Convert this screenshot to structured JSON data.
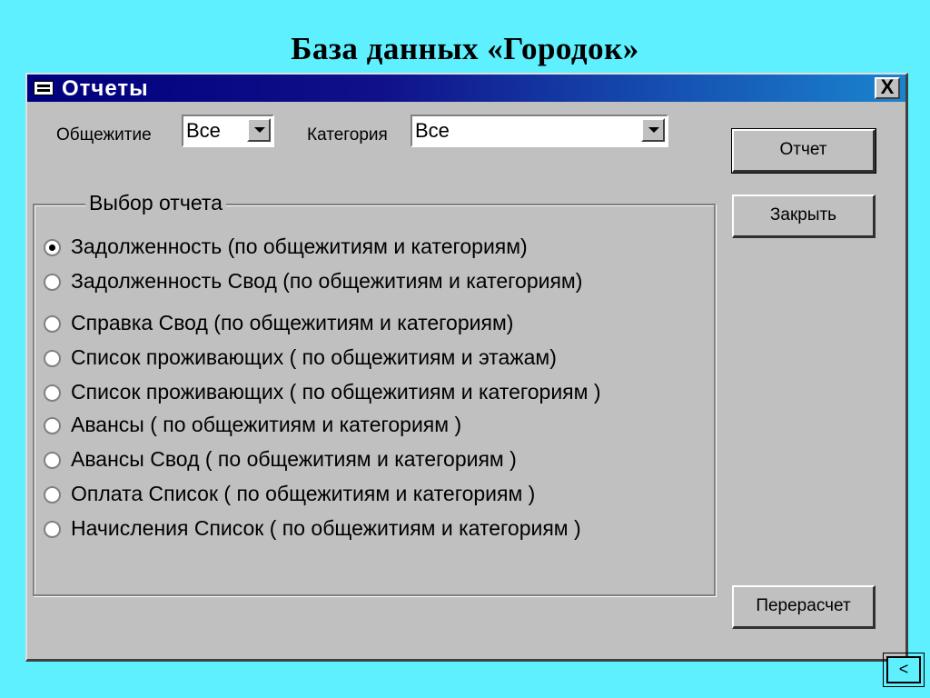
{
  "slide": {
    "title": "База данных «Городок»",
    "nav_label": "<"
  },
  "window": {
    "title": "Отчеты",
    "close_label": "X"
  },
  "filters": {
    "dorm_label": "Общежитие",
    "dorm_value": "Все",
    "category_label": "Категория",
    "category_value": "Все"
  },
  "buttons": {
    "report": "Отчет",
    "close": "Закрыть",
    "recalc": "Перерасчет"
  },
  "report_group": {
    "legend": "Выбор отчета",
    "selected_index": 0,
    "options": [
      "Задолженность (по общежитиям и категориям)",
      "Задолженность Свод (по общежитиям и категориям)",
      "Справка Свод (по общежитиям и категориям)",
      "Список  проживающих ( по общежитиям и этажам)",
      "Список  проживающих ( по общежитиям и категориям )",
      "Авансы ( по общежитиям и категориям )",
      "Авансы Свод ( по общежитиям и категориям )",
      "Оплата Список ( по общежитиям и категориям )",
      "Начисления Список ( по общежитиям и категориям )"
    ]
  },
  "colors": {
    "background": "#5ef0ff",
    "window": "#c0c0c0",
    "titlebar_start": "#00007e",
    "titlebar_end": "#1a84d0"
  }
}
